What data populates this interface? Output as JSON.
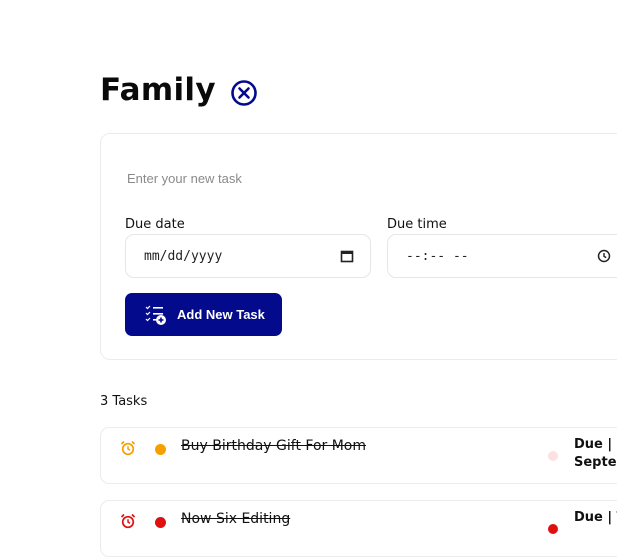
{
  "header": {
    "title": "Family",
    "close_icon": "circle-x-icon",
    "accent_color": "#040a8c"
  },
  "new_task": {
    "input_placeholder": "Enter your new task",
    "input_value": "",
    "due_date_label": "Due date",
    "due_date_value": "mm/dd/yyyy",
    "due_time_label": "Due time",
    "due_time_value": "--:-- --",
    "add_button_label": "Add New Task"
  },
  "tasks": {
    "count_label": "3 Tasks",
    "items": [
      {
        "name": "Buy Birthday Gift For Mom",
        "completed": true,
        "alarm_color": "#f5a000",
        "dot_color": "#f5a000",
        "priority_dot_color": "#fde0e0",
        "due_line1": "Due | F",
        "due_line2": "Septen"
      },
      {
        "name": "Now Six Editing",
        "completed": true,
        "alarm_color": "#e01010",
        "dot_color": "#e01010",
        "priority_dot_color": "#e01010",
        "due_line1": "Due | T",
        "due_line2": ""
      }
    ]
  }
}
